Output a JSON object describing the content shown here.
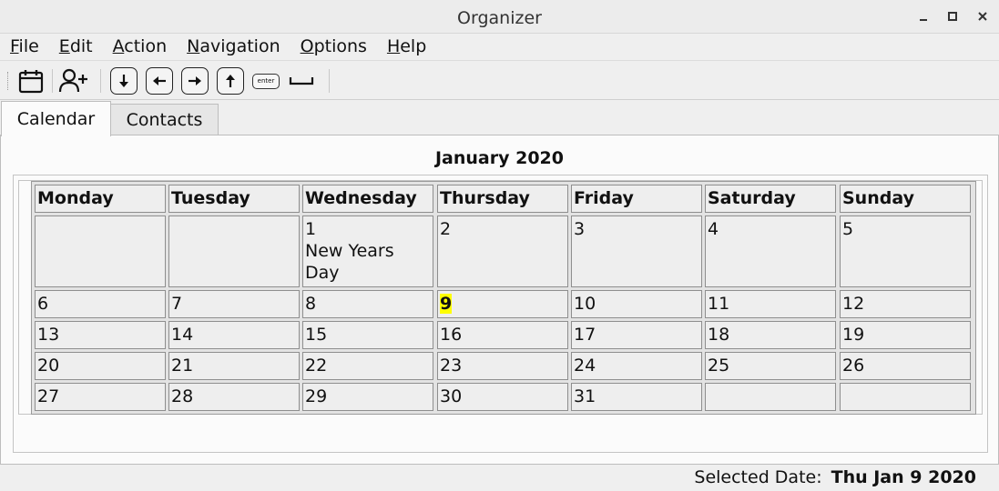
{
  "window": {
    "title": "Organizer"
  },
  "menu": [
    {
      "label": "File",
      "mnemonic": "F",
      "rest": "ile"
    },
    {
      "label": "Edit",
      "mnemonic": "E",
      "rest": "dit"
    },
    {
      "label": "Action",
      "mnemonic": "A",
      "rest": "ction"
    },
    {
      "label": "Navigation",
      "mnemonic": "N",
      "rest": "avigation"
    },
    {
      "label": "Options",
      "mnemonic": "O",
      "rest": "ptions"
    },
    {
      "label": "Help",
      "mnemonic": "H",
      "rest": "elp"
    }
  ],
  "toolbar": {
    "enter_label": "enter",
    "icons": [
      "calendar-icon",
      "add-contact-icon",
      "down-arrow-key-icon",
      "left-arrow-key-icon",
      "right-arrow-key-icon",
      "up-arrow-key-icon",
      "enter-key-icon",
      "space-key-icon"
    ]
  },
  "tabs": [
    {
      "label": "Calendar",
      "active": true
    },
    {
      "label": "Contacts",
      "active": false
    }
  ],
  "calendar": {
    "month_title": "January 2020",
    "days": [
      "Monday",
      "Tuesday",
      "Wednesday",
      "Thursday",
      "Friday",
      "Saturday",
      "Sunday"
    ],
    "weeks": [
      [
        {
          "day": ""
        },
        {
          "day": ""
        },
        {
          "day": "1",
          "event": "New Years Day"
        },
        {
          "day": "2"
        },
        {
          "day": "3"
        },
        {
          "day": "4"
        },
        {
          "day": "5"
        }
      ],
      [
        {
          "day": "6"
        },
        {
          "day": "7"
        },
        {
          "day": "8"
        },
        {
          "day": "9",
          "selected": true
        },
        {
          "day": "10"
        },
        {
          "day": "11"
        },
        {
          "day": "12"
        }
      ],
      [
        {
          "day": "13"
        },
        {
          "day": "14"
        },
        {
          "day": "15"
        },
        {
          "day": "16"
        },
        {
          "day": "17"
        },
        {
          "day": "18"
        },
        {
          "day": "19"
        }
      ],
      [
        {
          "day": "20"
        },
        {
          "day": "21"
        },
        {
          "day": "22"
        },
        {
          "day": "23"
        },
        {
          "day": "24"
        },
        {
          "day": "25"
        },
        {
          "day": "26"
        }
      ],
      [
        {
          "day": "27"
        },
        {
          "day": "28"
        },
        {
          "day": "29"
        },
        {
          "day": "30"
        },
        {
          "day": "31"
        },
        {
          "day": ""
        },
        {
          "day": ""
        }
      ]
    ],
    "highlight_color": "#ffff00"
  },
  "status": {
    "label": "Selected Date:",
    "value": "Thu Jan 9 2020"
  }
}
